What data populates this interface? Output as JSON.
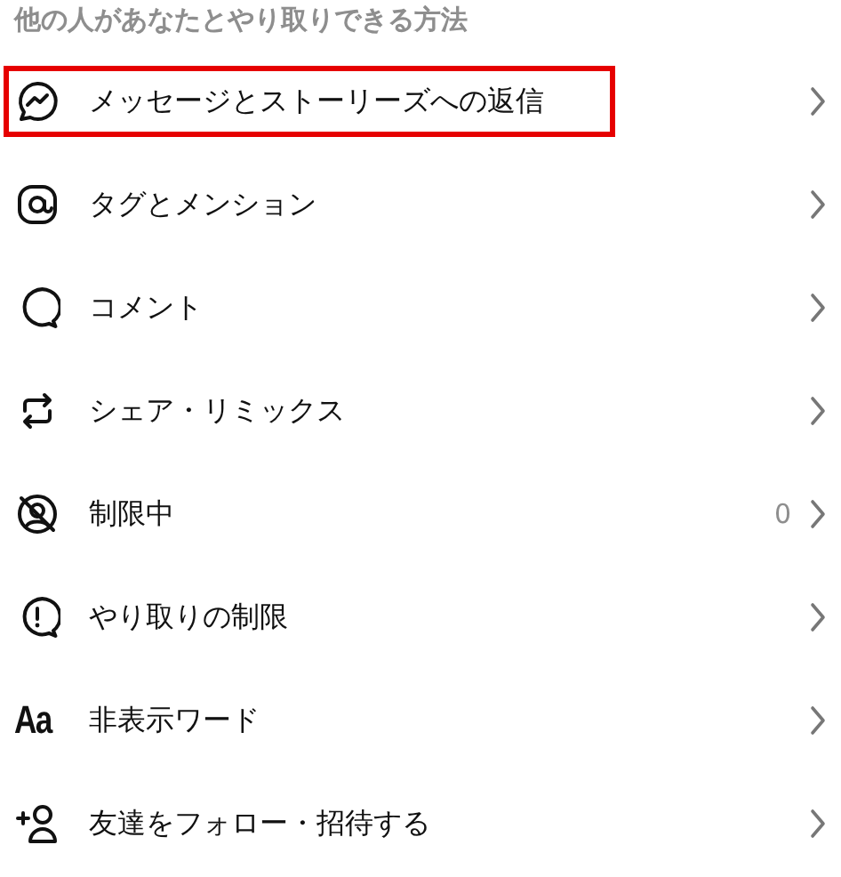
{
  "section_title": "他の人があなたとやり取りできる方法",
  "items": [
    {
      "kind": "messenger",
      "label": "メッセージとストーリーズへの返信",
      "highlighted": true
    },
    {
      "kind": "at",
      "label": "タグとメンション",
      "highlighted": false
    },
    {
      "kind": "comment",
      "label": "コメント",
      "highlighted": false
    },
    {
      "kind": "remix",
      "label": "シェア・リミックス",
      "highlighted": false
    },
    {
      "kind": "restricted",
      "label": "制限中",
      "count": "0",
      "highlighted": false
    },
    {
      "kind": "alert",
      "label": "やり取りの制限",
      "highlighted": false
    },
    {
      "kind": "text",
      "icon_text": "Aa",
      "label": "非表示ワード",
      "highlighted": false
    },
    {
      "kind": "addperson",
      "label": "友達をフォロー・招待する",
      "highlighted": false
    }
  ]
}
